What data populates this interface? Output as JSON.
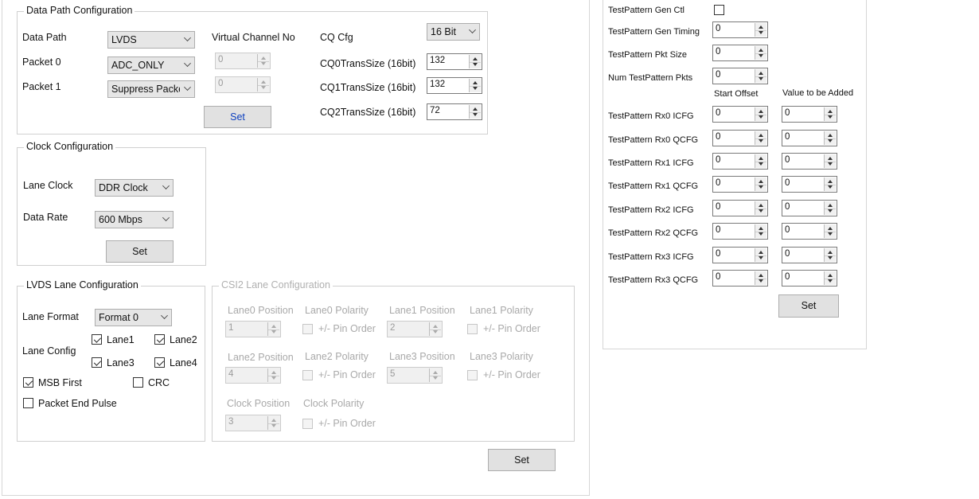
{
  "data_path_config": {
    "title": "Data Path Configuration",
    "data_path_label": "Data Path",
    "data_path_value": "LVDS",
    "packet0_label": "Packet 0",
    "packet0_value": "ADC_ONLY",
    "packet1_label": "Packet 1",
    "packet1_value": "Suppress Packet",
    "virtual_channel_label": "Virtual Channel No",
    "vc0_value": "0",
    "vc1_value": "0",
    "set_label": "Set",
    "cq_cfg_label": "CQ Cfg",
    "cq_cfg_value": "16 Bit",
    "cq0_label": "CQ0TransSize (16bit)",
    "cq0_value": "132",
    "cq1_label": "CQ1TransSize (16bit)",
    "cq1_value": "132",
    "cq2_label": "CQ2TransSize (16bit)",
    "cq2_value": "72"
  },
  "clock_config": {
    "title": "Clock Configuration",
    "lane_clock_label": "Lane Clock",
    "lane_clock_value": "DDR Clock",
    "data_rate_label": "Data Rate",
    "data_rate_value": "600 Mbps",
    "set_label": "Set"
  },
  "lvds_lane_config": {
    "title": "LVDS Lane Configuration",
    "lane_format_label": "Lane Format",
    "lane_format_value": "Format 0",
    "lane_config_label": "Lane Config",
    "lane1_label": "Lane1",
    "lane2_label": "Lane2",
    "lane3_label": "Lane3",
    "lane4_label": "Lane4",
    "msb_first_label": "MSB First",
    "crc_label": "CRC",
    "packet_end_pulse_label": "Packet End Pulse"
  },
  "csi2_lane_config": {
    "title": "CSI2 Lane Configuration",
    "lane0_position_label": "Lane0 Position",
    "lane0_position_value": "1",
    "lane0_polarity_label": "Lane0 Polarity",
    "lane1_position_label": "Lane1 Position",
    "lane1_position_value": "2",
    "lane1_polarity_label": "Lane1 Polarity",
    "lane2_position_label": "Lane2 Position",
    "lane2_position_value": "4",
    "lane2_polarity_label": "Lane2 Polarity",
    "lane3_position_label": "Lane3 Position",
    "lane3_position_value": "5",
    "lane3_polarity_label": "Lane3 Polarity",
    "clock_position_label": "Clock Position",
    "clock_position_value": "3",
    "clock_polarity_label": "Clock Polarity",
    "pin_order_label": "+/- Pin Order"
  },
  "main_set_label": "Set",
  "test_pattern": {
    "gen_ctl_label": "TestPattern Gen Ctl",
    "gen_timing_label": "TestPattern Gen Timing",
    "gen_timing_value": "0",
    "pkt_size_label": "TestPattern Pkt Size",
    "pkt_size_value": "0",
    "num_pkts_label": "Num TestPattern Pkts",
    "num_pkts_value": "0",
    "start_offset_header": "Start Offset",
    "value_added_header": "Value to be Added",
    "rows": [
      {
        "label": "TestPattern Rx0 ICFG",
        "offset": "0",
        "added": "0"
      },
      {
        "label": "TestPattern Rx0 QCFG",
        "offset": "0",
        "added": "0"
      },
      {
        "label": "TestPattern Rx1 ICFG",
        "offset": "0",
        "added": "0"
      },
      {
        "label": "TestPattern Rx1 QCFG",
        "offset": "0",
        "added": "0"
      },
      {
        "label": "TestPattern Rx2 ICFG",
        "offset": "0",
        "added": "0"
      },
      {
        "label": "TestPattern Rx2 QCFG",
        "offset": "0",
        "added": "0"
      },
      {
        "label": "TestPattern Rx3 ICFG",
        "offset": "0",
        "added": "0"
      },
      {
        "label": "TestPattern Rx3 QCFG",
        "offset": "0",
        "added": "0"
      }
    ],
    "set_label": "Set"
  }
}
